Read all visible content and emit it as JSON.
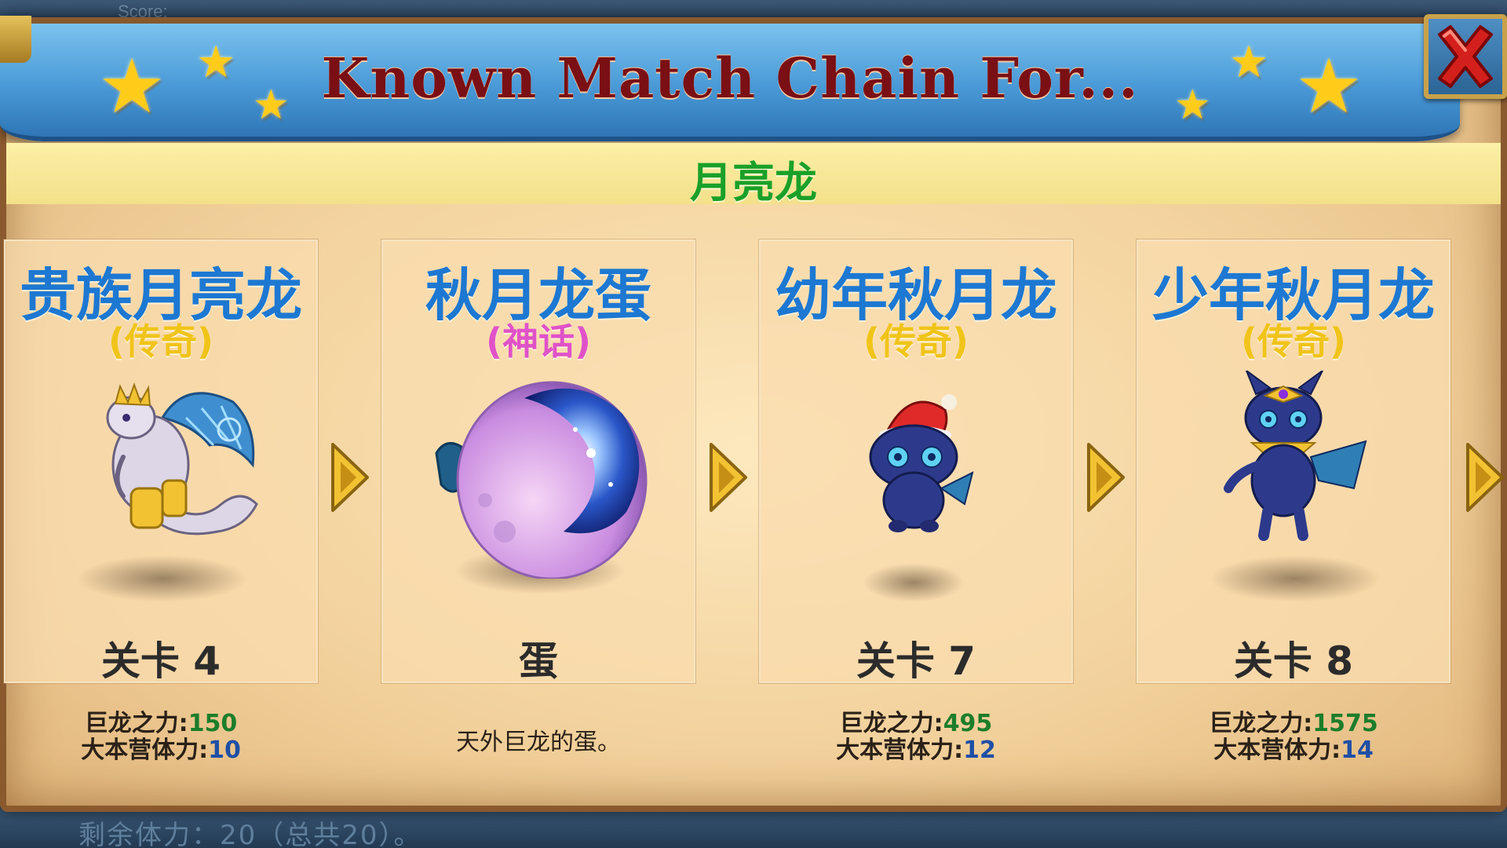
{
  "background": {
    "score_label": "Score:",
    "bottom_text": "剩余体力：20（总共20）。"
  },
  "header": {
    "title": "Known Match Chain For...",
    "subtitle": "月亮龙"
  },
  "close_button": {
    "icon": "close-x-icon",
    "color": "#d4201c"
  },
  "colors": {
    "name_blue": "#1d78d2",
    "legendary_yellow": "#f0c419",
    "mythic_pink": "#e052c8",
    "subtitle_green": "#1aa028",
    "dragon_power_green": "#1c7d2a",
    "camp_power_blue": "#1f4fa6"
  },
  "cards": [
    {
      "name": "贵族月亮龙",
      "rarity": "(传奇)",
      "rarity_color": "#f0c419",
      "level": "关卡 4",
      "art": "noble-moon-dragon-image",
      "stat_power_label": "巨龙之力:",
      "stat_power_value": "150",
      "stat_camp_label": "大本营体力:",
      "stat_camp_value": "10"
    },
    {
      "name": "秋月龙蛋",
      "rarity": "(神话)",
      "rarity_color": "#e052c8",
      "level": "蛋",
      "art": "autumn-moon-dragon-egg-image",
      "description": "天外巨龙的蛋。"
    },
    {
      "name": "幼年秋月龙",
      "rarity": "(传奇)",
      "rarity_color": "#f0c419",
      "level": "关卡 7",
      "art": "baby-autumn-moon-dragon-image",
      "stat_power_label": "巨龙之力:",
      "stat_power_value": "495",
      "stat_camp_label": "大本营体力:",
      "stat_camp_value": "12"
    },
    {
      "name": "少年秋月龙",
      "rarity": "(传奇)",
      "rarity_color": "#f0c419",
      "level": "关卡 8",
      "art": "teen-autumn-moon-dragon-image",
      "stat_power_label": "巨龙之力:",
      "stat_power_value": "1575",
      "stat_camp_label": "大本营体力:",
      "stat_camp_value": "14"
    }
  ]
}
